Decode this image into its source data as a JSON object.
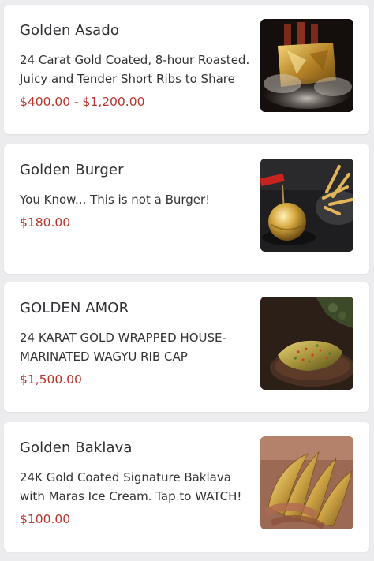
{
  "menu": {
    "items": [
      {
        "name": "Golden Asado",
        "description": "24 Carat Gold Coated, 8-hour Roasted. Juicy and Tender Short Ribs to Share",
        "price": "$400.00 - $1,200.00",
        "image_icon": "gold-short-ribs-photo"
      },
      {
        "name": "Golden Burger",
        "description": "You Know... This is not a Burger!",
        "price": "$180.00",
        "image_icon": "gold-burger-photo"
      },
      {
        "name": "GOLDEN AMOR",
        "description": "24 KARAT GOLD WRAPPED HOUSE-MARINATED WAGYU RIB CAP",
        "price": "$1,500.00",
        "image_icon": "gold-steak-photo"
      },
      {
        "name": "Golden Baklava",
        "description": "24K Gold Coated Signature Baklava with Maras Ice Cream. Tap to WATCH!",
        "price": "$100.00",
        "image_icon": "gold-baklava-photo"
      }
    ]
  },
  "colors": {
    "price": "#b8342c",
    "background": "#ececee",
    "card": "#ffffff"
  }
}
